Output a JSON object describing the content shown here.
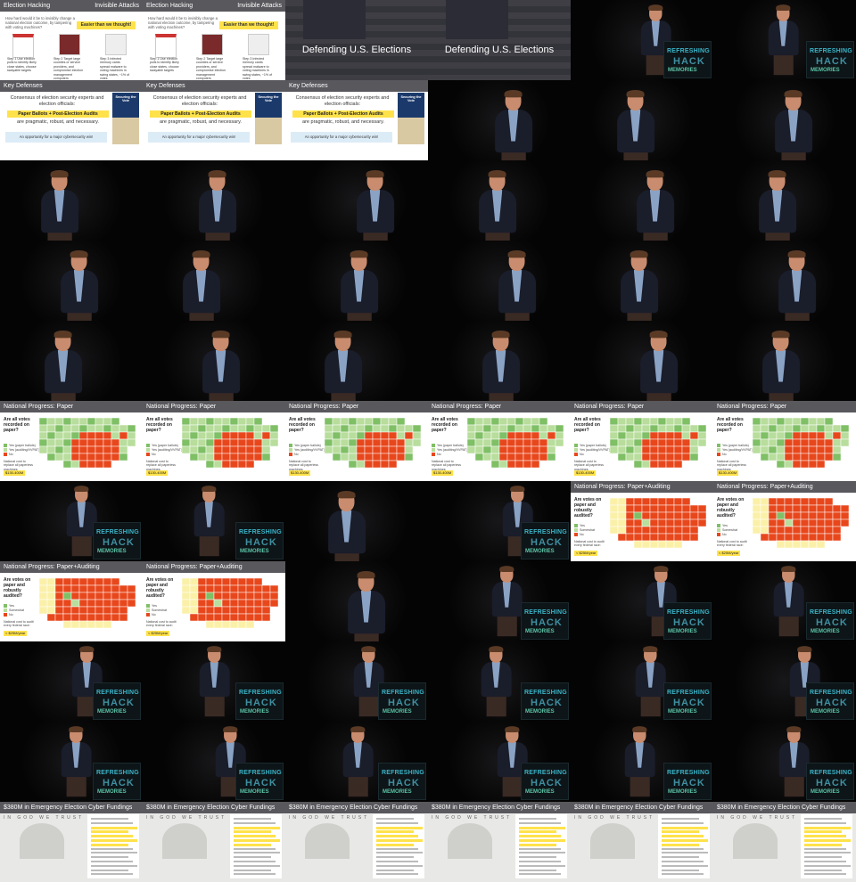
{
  "slides": {
    "election_hacking": {
      "title": "Election Hacking",
      "right": "Invisible Attacks",
      "question": "How hard would it be to invisibly change a national election outcome, by tampering with voting machines?",
      "easier": "Easier than we thought!",
      "steps": [
        "Step 1 Use election polls to identify likely close states, choose swayable targets",
        "Step 2 Target large counties or service providers, and compromise election management computers",
        "Step 3 Infected memory cards spread malware to voting machines in swing states, ~1% of votes"
      ]
    },
    "defending": {
      "title": "Defending U.S. Elections"
    },
    "key_defenses": {
      "title": "Key Defenses",
      "line1": "Consensus of election security experts and election officials:",
      "highlight": "Paper Ballots + Post-Election Audits",
      "line2": "are pragmatic, robust, and necessary.",
      "opportunity": "An opportunity for a major cybersecurity win!",
      "book": "Securing the Vote"
    },
    "paper": {
      "title": "National Progress: Paper",
      "question": "Are all votes recorded on paper?",
      "legend": [
        "Yes (paper ballots)",
        "Yes (auditing/VVPAT)",
        "No"
      ],
      "cost": "National cost to replace all paperless machines:",
      "amount": "$130-400M"
    },
    "auditing": {
      "title": "National Progress: Paper+Auditing",
      "question": "Are votes on paper and robustly audited?",
      "legend": [
        "Yes",
        "Somewhat",
        "No"
      ],
      "cost": "National cost to audit every federal race:",
      "amount": "< $25M/year"
    },
    "cyber": {
      "title": "$380M in Emergency Election Cyber Fundings",
      "motto": "IN GOD WE TRUST"
    }
  },
  "stage_logo": {
    "line1": "REFRESHING",
    "line2": "HACK",
    "line3": "MEMORIES"
  },
  "colors": {
    "header": "#58585d",
    "highlight": "#ffe24a",
    "map_red": "#e8471c",
    "map_green": "#7fbf65",
    "map_light": "#b8dd9c",
    "map_yellow": "#fbf0a8"
  }
}
